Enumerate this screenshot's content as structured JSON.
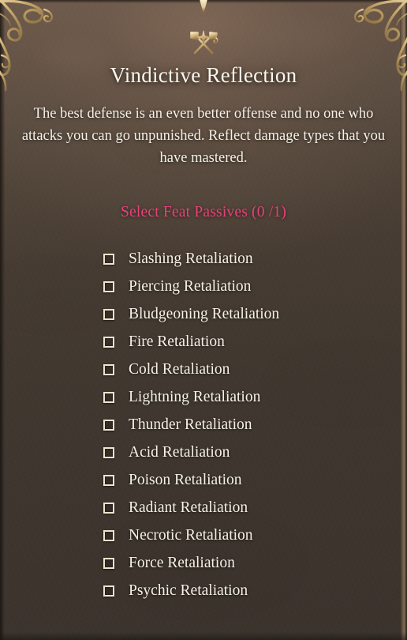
{
  "panel": {
    "crest_icon": "crossed-axe-hammer-icon",
    "notch_icon": "top-pointer-notch-icon",
    "corner_ornament_icon": "filigree-scroll-ornament-icon",
    "title": "Vindictive Reflection",
    "description": "The best defense is an even better offense and no one who attacks you can go unpunished. Reflect damage types that you have mastered."
  },
  "section": {
    "heading": "Select Feat Passives",
    "count": "(0 /1)",
    "selected": 0,
    "max": 1
  },
  "passives": [
    {
      "label": "Slashing Retaliation",
      "checked": false
    },
    {
      "label": "Piercing Retaliation",
      "checked": false
    },
    {
      "label": "Bludgeoning Retaliation",
      "checked": false
    },
    {
      "label": "Fire Retaliation",
      "checked": false
    },
    {
      "label": "Cold Retaliation",
      "checked": false
    },
    {
      "label": "Lightning Retaliation",
      "checked": false
    },
    {
      "label": "Thunder Retaliation",
      "checked": false
    },
    {
      "label": "Acid Retaliation",
      "checked": false
    },
    {
      "label": "Poison Retaliation",
      "checked": false
    },
    {
      "label": "Radiant Retaliation",
      "checked": false
    },
    {
      "label": "Necrotic Retaliation",
      "checked": false
    },
    {
      "label": "Force Retaliation",
      "checked": false
    },
    {
      "label": "Psychic Retaliation",
      "checked": false
    }
  ],
  "colors": {
    "accent_pink": "#e8417c",
    "text_cream": "#f7f2e6",
    "title_cream": "#fbf6ec",
    "ornament_gold": "#c9a86a",
    "panel_brown_top": "#6d5b4d",
    "panel_brown_bottom": "#3a332c",
    "checkbox_border": "#eee4ce"
  }
}
